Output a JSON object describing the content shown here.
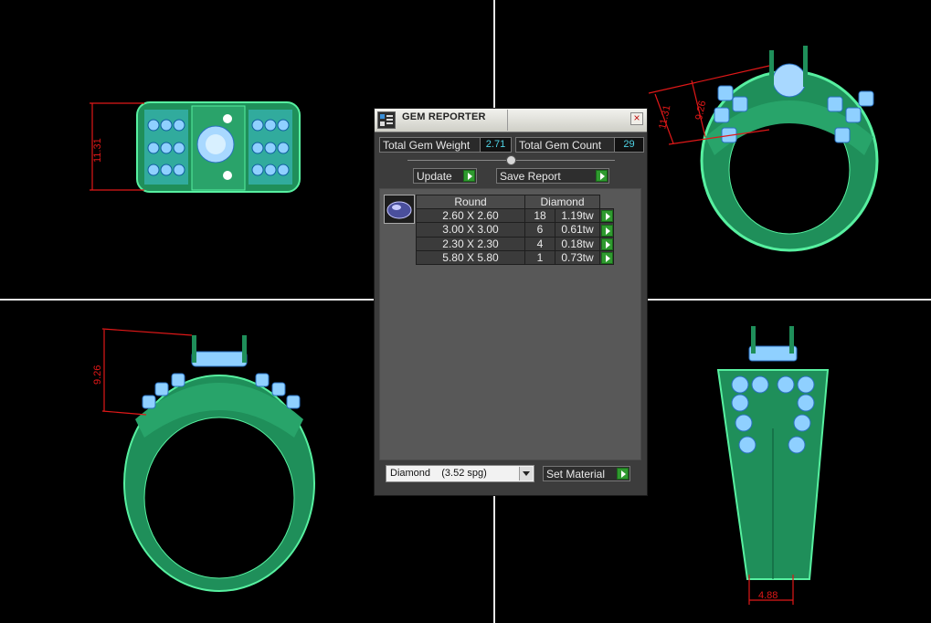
{
  "app": {
    "panel_title": "GEM REPORTER"
  },
  "stats": {
    "total_gem_weight_label": "Total Gem Weight",
    "total_gem_weight_value": "2.71",
    "total_gem_count_label": "Total Gem Count",
    "total_gem_count_value": "29"
  },
  "buttons": {
    "update_label": "Update",
    "save_report_label": "Save Report",
    "set_material_label": "Set Material"
  },
  "table": {
    "header_shape": "Round",
    "header_material": "Diamond",
    "rows": [
      {
        "size": "2.60 X 2.60",
        "count": "18",
        "weight": "1.19tw"
      },
      {
        "size": "3.00 X 3.00",
        "count": "6",
        "weight": "0.61tw"
      },
      {
        "size": "2.30 X 2.30",
        "count": "4",
        "weight": "0.18tw"
      },
      {
        "size": "5.80 X 5.80",
        "count": "1",
        "weight": "0.73tw"
      }
    ]
  },
  "material_select": {
    "value": "Diamond    (3.52 spg)"
  },
  "viewports": {
    "top_left_dimension": "11.31",
    "top_right_dimension_1": "11.31",
    "top_right_dimension_2": "9.26",
    "bottom_left_dimension": "9.26",
    "bottom_right_dimension": "4.88"
  },
  "colors": {
    "ring_green": "#1f8f5a",
    "gem_blue": "#7ec6ff",
    "dimension_red": "#e01818",
    "panel_bg": "#3c3c3c",
    "value_cyan": "#4fd4e6",
    "go_green": "#2f9a2f"
  },
  "icons": [
    "gem-reporter-icon",
    "close-icon",
    "go-arrow-icon",
    "dropdown-arrow-icon",
    "gem-thumbnail-icon"
  ]
}
